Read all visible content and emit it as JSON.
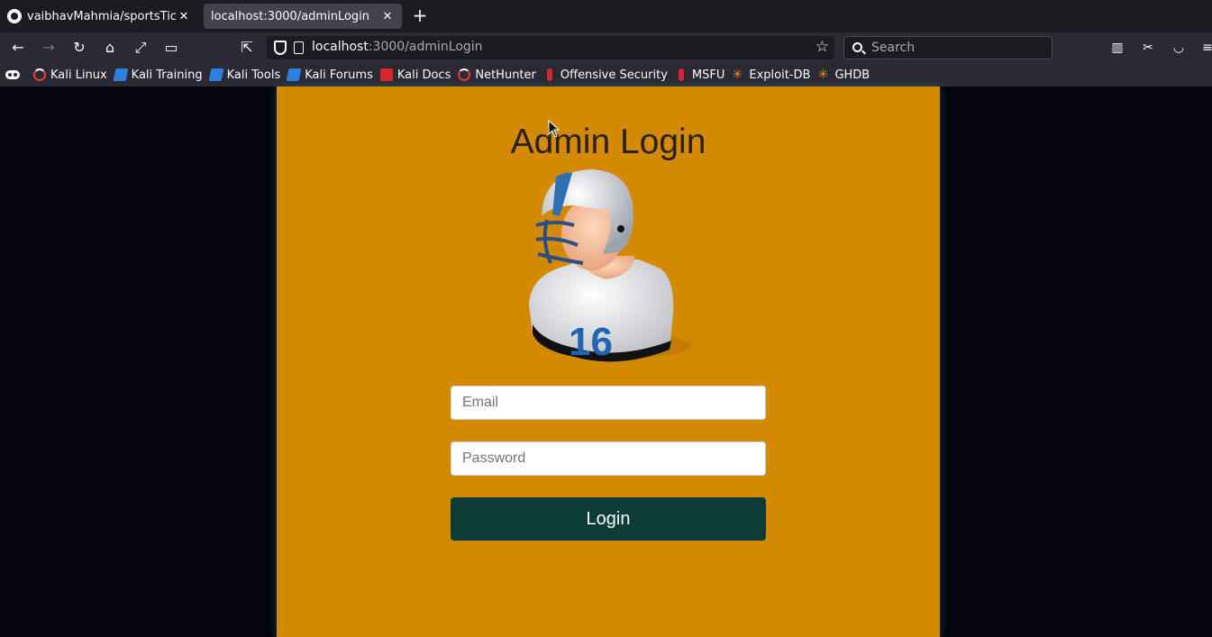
{
  "browser": {
    "tabs": [
      {
        "title": "vaibhavMahmia/sportsTick",
        "active": false,
        "icon": "github-icon"
      },
      {
        "title": "localhost:3000/adminLogin",
        "active": true
      }
    ],
    "url": {
      "host": "localhost",
      "path": ":3000/adminLogin"
    },
    "search_placeholder": "Search",
    "bookmarks": [
      {
        "label": "Kali Linux",
        "icon": "kali-icon"
      },
      {
        "label": "Kali Training",
        "icon": "kali-tools-icon"
      },
      {
        "label": "Kali Tools",
        "icon": "kali-tools-icon"
      },
      {
        "label": "Kali Forums",
        "icon": "kali-tools-icon"
      },
      {
        "label": "Kali Docs",
        "icon": "docs-icon"
      },
      {
        "label": "NetHunter",
        "icon": "kali-icon"
      },
      {
        "label": "Offensive Security",
        "icon": "thermometer-icon"
      },
      {
        "label": "MSFU",
        "icon": "thermometer-icon"
      },
      {
        "label": "Exploit-DB",
        "icon": "spider-icon"
      },
      {
        "label": "GHDB",
        "icon": "spider-icon"
      }
    ]
  },
  "page": {
    "title": "Admin Login",
    "avatar_number": "16",
    "email_placeholder": "Email",
    "password_placeholder": "Password",
    "login_label": "Login"
  },
  "colors": {
    "card_bg": "#d48a00",
    "button_bg": "#0b3d36",
    "page_bg": "#05050f"
  }
}
